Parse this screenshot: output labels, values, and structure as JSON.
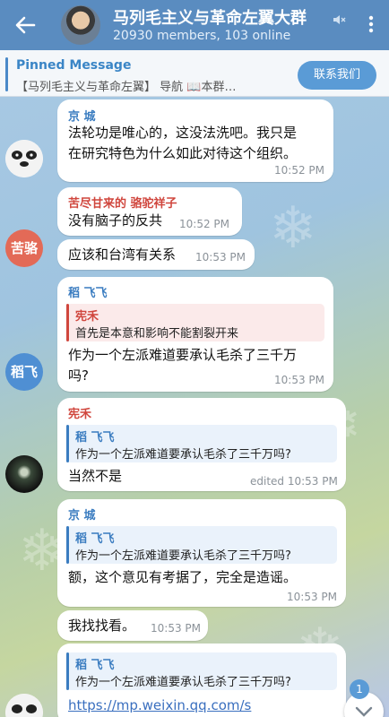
{
  "header": {
    "title": "马列毛主义与革命左翼大群",
    "subtitle": "20930 members, 103 online"
  },
  "pinned": {
    "title": "Pinned Message",
    "text": "【马列毛主义与革命左翼】 导航 📖本群…",
    "button": "联系我们"
  },
  "messages": [
    {
      "sender": "京 城",
      "lines": [
        "法轮功是唯心的，这没法洗吧。我只是",
        "在研究特色为什么如此对待这个组织。"
      ],
      "time": "10:52 PM"
    },
    {
      "sender": "苦尽甘来的 骆驼祥子",
      "lines": [
        "没有脑子的反共"
      ],
      "time": "10:52 PM"
    },
    {
      "lines": [
        "应该和台湾有关系"
      ],
      "time": "10:53 PM"
    },
    {
      "sender": "稻 飞飞",
      "reply_name": "宪禾",
      "reply_text": "首先是本意和影响不能割裂开来",
      "lines": [
        "作为一个左派难道要承认毛杀了三千万",
        "吗?"
      ],
      "time": "10:53 PM"
    },
    {
      "sender": "宪禾",
      "reply_name": "稻 飞飞",
      "reply_text": "作为一个左派难道要承认毛杀了三千万吗?",
      "lines": [
        "当然不是"
      ],
      "time": "edited 10:53 PM"
    },
    {
      "sender": "京 城",
      "reply_name": "稻 飞飞",
      "reply_text": "作为一个左派难道要承认毛杀了三千万吗?",
      "lines": [
        "额，这个意见有考据了，完全是造谣。"
      ],
      "time": "10:53 PM"
    },
    {
      "lines": [
        "我找找看。"
      ],
      "time": "10:53 PM"
    },
    {
      "reply_name": "稻 飞飞",
      "reply_text": "作为一个左派难道要承认毛杀了三千万吗?",
      "link": "https://mp.weixin.qq.com/s"
    }
  ],
  "avatars": {
    "kujin": "苦骆",
    "daofei": "稻飞"
  },
  "unread_badge": "1",
  "colors": {
    "header_bg": "#5a8cc0",
    "accent": "#3a85c6",
    "sender_jingcheng": "#3a7cc0",
    "sender_kujin": "#d0463d",
    "sender_daofei": "#3a7cc0",
    "sender_xianhe": "#d0463d"
  }
}
